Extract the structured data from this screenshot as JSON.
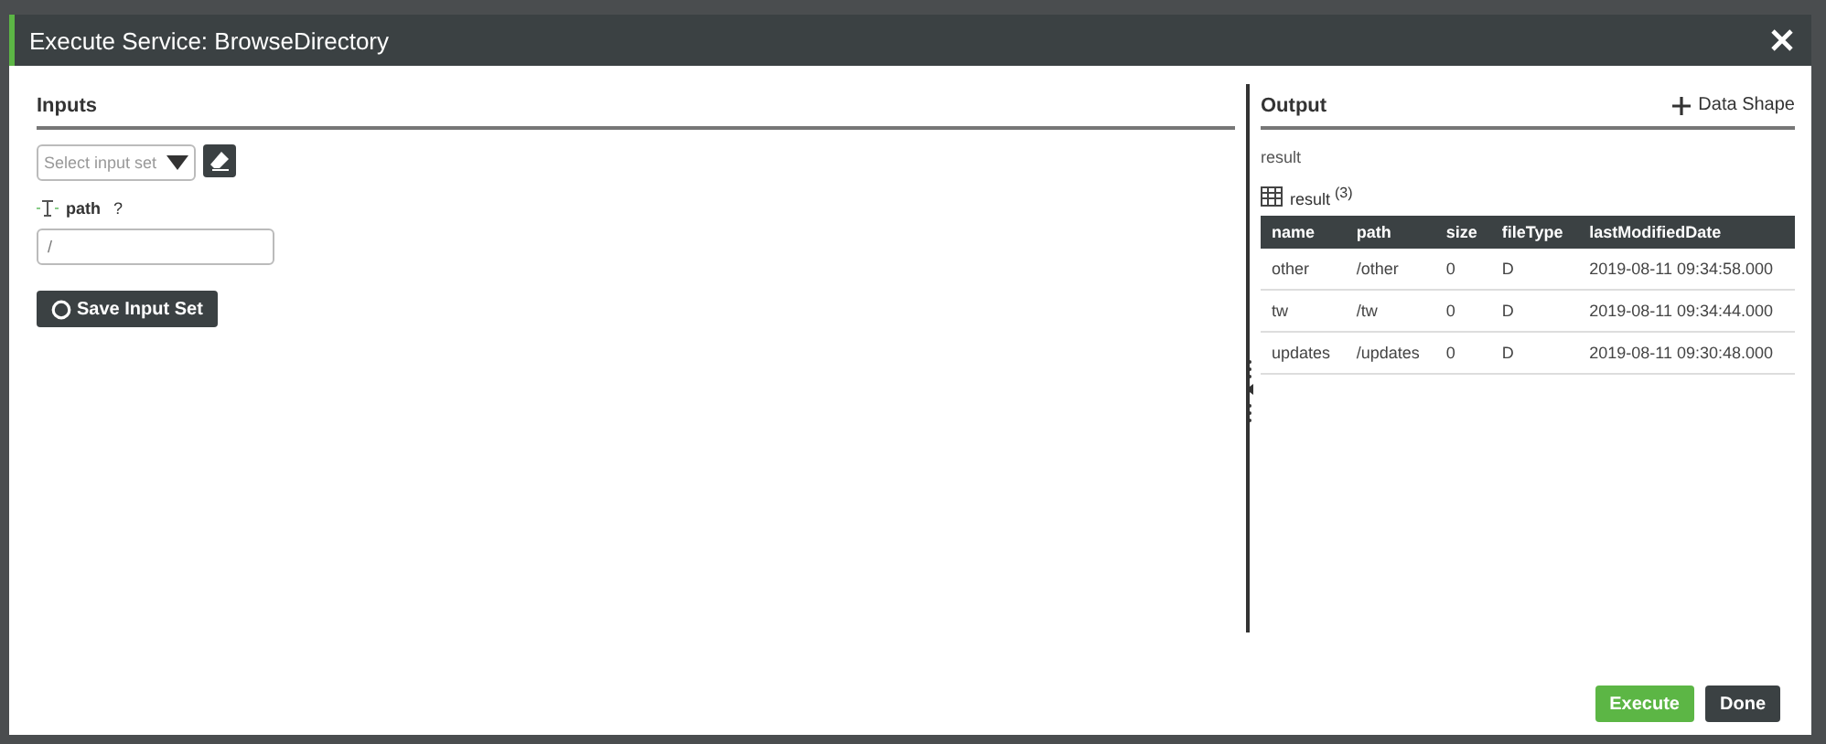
{
  "dialog": {
    "title": "Execute Service: BrowseDirectory"
  },
  "inputs": {
    "heading": "Inputs",
    "input_set": {
      "placeholder": "Select input set"
    },
    "parameters": [
      {
        "name": "path",
        "help": "?",
        "value": "/"
      }
    ],
    "save_button": "Save Input Set"
  },
  "output": {
    "heading": "Output",
    "data_shape_button": "Data Shape",
    "result_label": "result",
    "table_title": "result",
    "table_count": "(3)",
    "columns": [
      "name",
      "path",
      "size",
      "fileType",
      "lastModifiedDate"
    ],
    "rows": [
      [
        "other",
        "/other",
        "0",
        "D",
        "2019-08-11 09:34:58.000"
      ],
      [
        "tw",
        "/tw",
        "0",
        "D",
        "2019-08-11 09:34:44.000"
      ],
      [
        "updates",
        "/updates",
        "0",
        "D",
        "2019-08-11 09:30:48.000"
      ]
    ]
  },
  "buttons": [
    {
      "label": "Execute",
      "kind": "primary"
    },
    {
      "label": "Done",
      "kind": "secondary"
    }
  ]
}
